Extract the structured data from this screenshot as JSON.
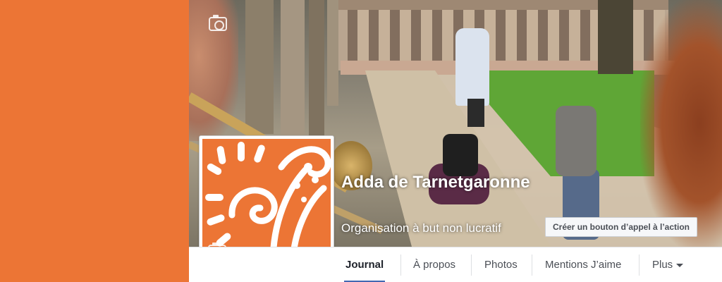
{
  "page": {
    "name": "Adda de Tarnetgaronne",
    "category": "Organisation à but non lucratif"
  },
  "actions": {
    "cta_label": "Créer un bouton d’appel à l’action"
  },
  "tabs": [
    {
      "label": "Journal",
      "active": true
    },
    {
      "label": "À propos",
      "active": false
    },
    {
      "label": "Photos",
      "active": false
    },
    {
      "label": "Mentions J’aime",
      "active": false
    },
    {
      "label": "Plus",
      "active": false
    }
  ],
  "icons": {
    "cover_camera": "camera-icon",
    "profile_camera": "camera-icon",
    "more_caret": "caret-down-icon"
  },
  "colors": {
    "brand_orange": "#ec7535",
    "tab_active_underline": "#4267b2"
  }
}
